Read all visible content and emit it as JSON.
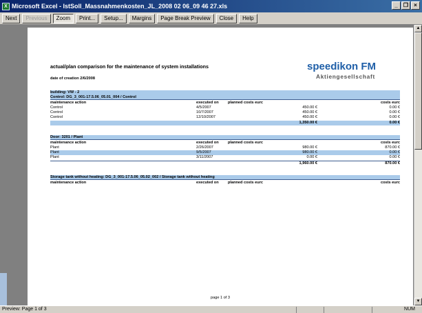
{
  "window": {
    "title": "Microsoft Excel - IstSoll_Massnahmenkosten_JL_2008 02 06_09 46 27.xls",
    "controls": [
      "_",
      "❐",
      "×"
    ]
  },
  "toolbar": {
    "next": "Next",
    "previous": "Previous",
    "zoom": "Zoom",
    "print": "Print...",
    "setup": "Setup...",
    "margins": "Margins",
    "page_break_preview": "Page Break Preview",
    "close": "Close",
    "help": "Help"
  },
  "report": {
    "title": "actual/plan comparison for the maintenance of system installations",
    "date": "date of creation 2/6/2008",
    "brand": "speedikon FM",
    "brand_sub": "Aktiengesellschaft",
    "page": "page 1 of 3",
    "building": "building: VW - 2",
    "section1": {
      "title": "Control: DG_3_001-17.5.06_05.01_004 / Control",
      "headers": [
        "maintenance action",
        "executed on",
        "planned costs eurc",
        "costs eurc"
      ],
      "rows": [
        [
          "Control",
          "4/5/2007",
          "450.00 €",
          "0.00 €"
        ],
        [
          "Control",
          "10/7/2007",
          "450.00 €",
          "0.00 €"
        ],
        [
          "Control",
          "12/10/2007",
          "450.00 €",
          "0.00 €"
        ]
      ],
      "total": [
        "1,350.00 €",
        "0.00 €"
      ]
    },
    "section2": {
      "title": "Door: 3201 / Plant",
      "headers": [
        "maintenance action",
        "executed on",
        "planned costs eurc",
        "costs eurc"
      ],
      "rows": [
        [
          "Plant",
          "2/26/2007",
          "980.00 €",
          "870.00 €"
        ],
        [
          "Plant",
          "9/5/2007",
          "980.00 €",
          "0.00 €"
        ],
        [
          "Plant",
          "3/11/2007",
          "0.00 €",
          "0.00 €"
        ]
      ],
      "total": [
        "1,960.00 €",
        "870.00 €"
      ]
    },
    "section3": {
      "title": "Storage tank without heating: DG_3_001-17.5.06_05.02_002 / Storage tank without heating",
      "headers": [
        "maintenance action",
        "executed on",
        "planned costs eurc",
        "costs eurc"
      ]
    }
  },
  "statusbar": {
    "left": "Preview: Page 1 of 3",
    "right": "NUM"
  }
}
